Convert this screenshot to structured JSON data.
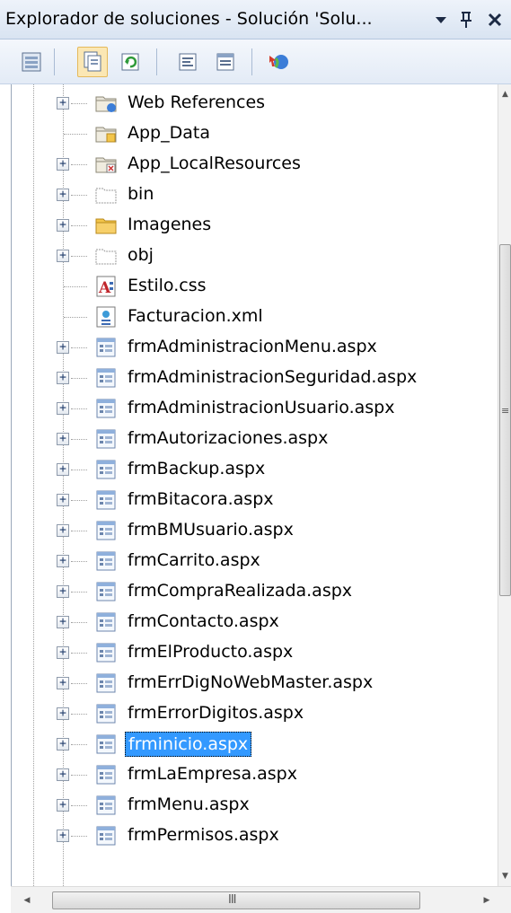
{
  "window": {
    "title": "Explorador de soluciones - Solución 'Solu...",
    "dropdown_glyph": "▾",
    "pin_glyph": "⨅",
    "close_glyph": "✕"
  },
  "toolbar": {
    "buttons": [
      {
        "name": "properties-icon"
      },
      {
        "name": "show-all-files-icon",
        "pressed": true
      },
      {
        "name": "refresh-icon"
      },
      {
        "name": "view-code-icon"
      },
      {
        "name": "view-designer-icon"
      },
      {
        "name": "copy-website-icon"
      }
    ]
  },
  "tree": {
    "items": [
      {
        "label": "Web References",
        "icon": "web-references-folder-icon",
        "expandable": true
      },
      {
        "label": "App_Data",
        "icon": "app-data-folder-icon",
        "expandable": false
      },
      {
        "label": "App_LocalResources",
        "icon": "local-resources-folder-icon",
        "expandable": true
      },
      {
        "label": "bin",
        "icon": "hidden-folder-icon",
        "expandable": true
      },
      {
        "label": "Imagenes",
        "icon": "folder-icon",
        "expandable": true
      },
      {
        "label": "obj",
        "icon": "hidden-folder-icon",
        "expandable": true
      },
      {
        "label": "Estilo.css",
        "icon": "css-file-icon",
        "expandable": false
      },
      {
        "label": "Facturacion.xml",
        "icon": "xml-file-icon",
        "expandable": false
      },
      {
        "label": "frmAdministracionMenu.aspx",
        "icon": "aspx-file-icon",
        "expandable": true
      },
      {
        "label": "frmAdministracionSeguridad.aspx",
        "icon": "aspx-file-icon",
        "expandable": true
      },
      {
        "label": "frmAdministracionUsuario.aspx",
        "icon": "aspx-file-icon",
        "expandable": true
      },
      {
        "label": "frmAutorizaciones.aspx",
        "icon": "aspx-file-icon",
        "expandable": true
      },
      {
        "label": "frmBackup.aspx",
        "icon": "aspx-file-icon",
        "expandable": true
      },
      {
        "label": "frmBitacora.aspx",
        "icon": "aspx-file-icon",
        "expandable": true
      },
      {
        "label": "frmBMUsuario.aspx",
        "icon": "aspx-file-icon",
        "expandable": true
      },
      {
        "label": "frmCarrito.aspx",
        "icon": "aspx-file-icon",
        "expandable": true
      },
      {
        "label": "frmCompraRealizada.aspx",
        "icon": "aspx-file-icon",
        "expandable": true
      },
      {
        "label": "frmContacto.aspx",
        "icon": "aspx-file-icon",
        "expandable": true
      },
      {
        "label": "frmElProducto.aspx",
        "icon": "aspx-file-icon",
        "expandable": true
      },
      {
        "label": "frmErrDigNoWebMaster.aspx",
        "icon": "aspx-file-icon",
        "expandable": true
      },
      {
        "label": "frmErrorDigitos.aspx",
        "icon": "aspx-file-icon",
        "expandable": true
      },
      {
        "label": "frminicio.aspx",
        "icon": "aspx-file-icon",
        "expandable": true,
        "selected": true
      },
      {
        "label": "frmLaEmpresa.aspx",
        "icon": "aspx-file-icon",
        "expandable": true
      },
      {
        "label": "frmMenu.aspx",
        "icon": "aspx-file-icon",
        "expandable": true
      },
      {
        "label": "frmPermisos.aspx",
        "icon": "aspx-file-icon",
        "expandable": true
      }
    ]
  },
  "scrollbars": {
    "vertical_grip": "≡",
    "horizontal_grip": "III",
    "left_arrow": "◀",
    "right_arrow": "▶",
    "up_arrow": "▲",
    "down_arrow": "▼"
  },
  "colors": {
    "selection": "#3399ff",
    "titlebar": "#d9e4f2",
    "folder": "#f3c54a"
  }
}
